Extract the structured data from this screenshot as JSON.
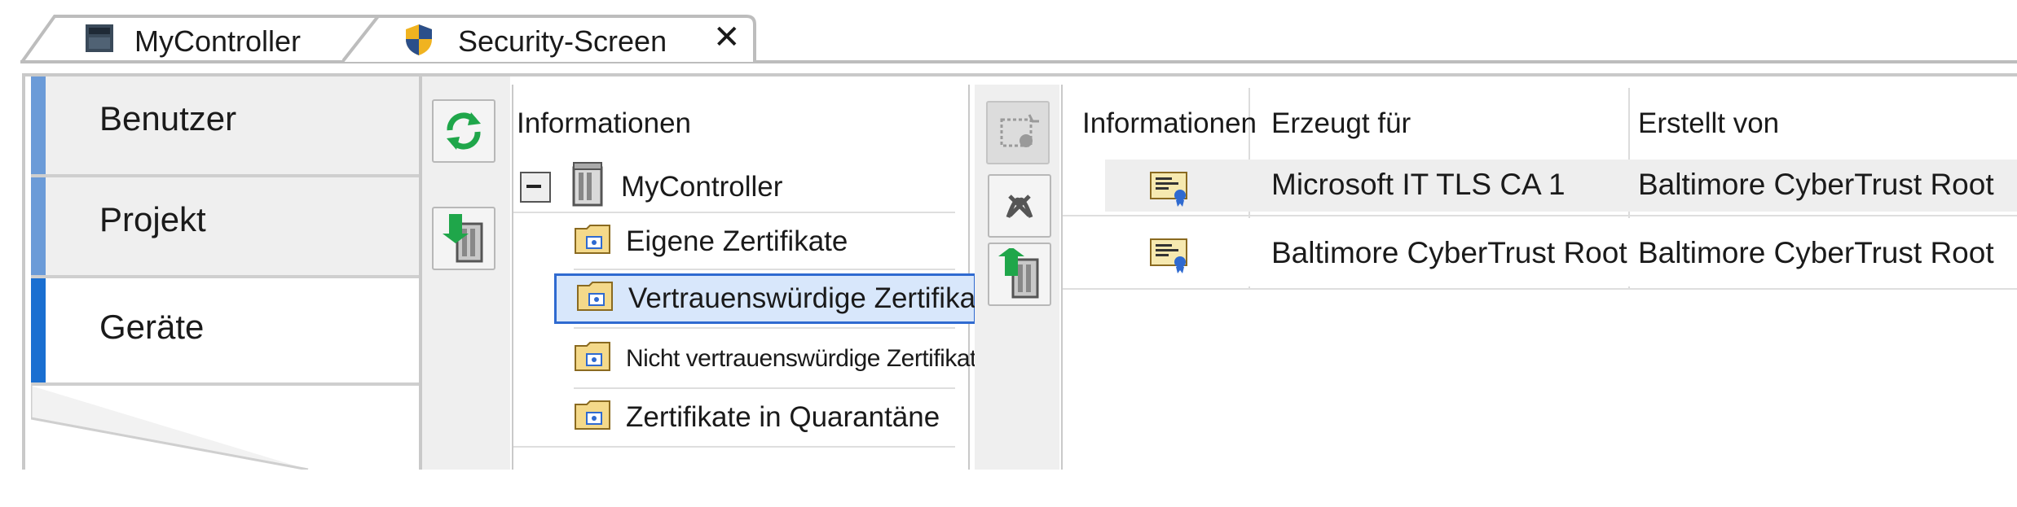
{
  "tabs": [
    {
      "label": "MyController",
      "icon": "controller-icon"
    },
    {
      "label": "Security-Screen",
      "icon": "shield-icon",
      "close": "✕"
    }
  ],
  "sidebar": {
    "items": [
      {
        "label": "Benutzer",
        "active": false
      },
      {
        "label": "Projekt",
        "active": false
      },
      {
        "label": "Geräte",
        "active": true
      }
    ]
  },
  "tree": {
    "header": "Informationen",
    "root": {
      "label": "MyController",
      "expander": "−"
    },
    "items": [
      {
        "label": "Eigene Zertifikate"
      },
      {
        "label": "Vertrauenswürdige Zertifikate",
        "selected": true
      },
      {
        "label": "Nicht vertrauenswürdige Zertifikate"
      },
      {
        "label": "Zertifikate in Quarantäne"
      }
    ]
  },
  "table": {
    "columns": [
      "Informationen",
      "Erzeugt für",
      "Erstellt von"
    ],
    "rows": [
      {
        "icon": "certificate-icon",
        "created_for": "Microsoft IT TLS CA 1",
        "created_by": "Baltimore CyberTrust Root"
      },
      {
        "icon": "certificate-icon",
        "created_for": "Baltimore CyberTrust Root",
        "created_by": "Baltimore CyberTrust Root"
      }
    ]
  },
  "colors": {
    "sidebar_bar": "#6b9bd8",
    "sidebar_bar_active": "#1a6fd1",
    "selection_border": "#2f6ad0",
    "selection_fill": "#d8e7fb",
    "folder": "#f4d98a",
    "arrow_green": "#1fa64a"
  }
}
